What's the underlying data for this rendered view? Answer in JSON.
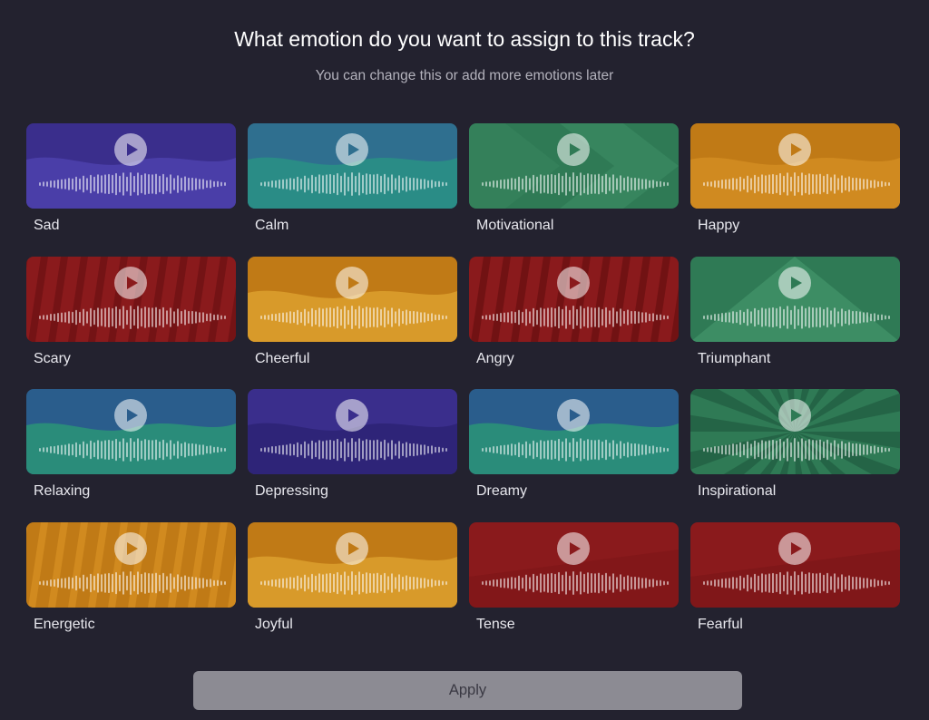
{
  "header": {
    "title": "What emotion do you want to assign to this track?",
    "subtitle": "You can change this or add more emotions later"
  },
  "emotions": [
    {
      "label": "Sad",
      "color": "#3a2e8c",
      "accent": "#4a3ea8",
      "pattern": "wave"
    },
    {
      "label": "Calm",
      "color": "#2f6f8f",
      "accent": "#2a8c86",
      "pattern": "wave"
    },
    {
      "label": "Motivational",
      "color": "#2f7a55",
      "accent": "#3b8a62",
      "pattern": "chevron"
    },
    {
      "label": "Happy",
      "color": "#c07a16",
      "accent": "#d08a20",
      "pattern": "wave"
    },
    {
      "label": "Scary",
      "color": "#8a1a1c",
      "accent": "#6e1214",
      "pattern": "spikes"
    },
    {
      "label": "Cheerful",
      "color": "#c07a16",
      "accent": "#d89a2a",
      "pattern": "wave"
    },
    {
      "label": "Angry",
      "color": "#8a1a1c",
      "accent": "#6a1012",
      "pattern": "spikes"
    },
    {
      "label": "Triumphant",
      "color": "#2f7a55",
      "accent": "#3d8d64",
      "pattern": "triangle"
    },
    {
      "label": "Relaxing",
      "color": "#2a5d8c",
      "accent": "#2a8c7a",
      "pattern": "wave"
    },
    {
      "label": "Depressing",
      "color": "#3a2e8c",
      "accent": "#2e2478",
      "pattern": "wave"
    },
    {
      "label": "Dreamy",
      "color": "#2a5d8c",
      "accent": "#2a8c7a",
      "pattern": "wave"
    },
    {
      "label": "Inspirational",
      "color": "#2f7a55",
      "accent": "#246446",
      "pattern": "rays"
    },
    {
      "label": "Energetic",
      "color": "#c07a16",
      "accent": "#d48e22",
      "pattern": "spikes"
    },
    {
      "label": "Joyful",
      "color": "#c07a16",
      "accent": "#d89a2a",
      "pattern": "wave"
    },
    {
      "label": "Tense",
      "color": "#8a1a1c",
      "accent": "#7a1416",
      "pattern": "plain"
    },
    {
      "label": "Fearful",
      "color": "#8a1a1c",
      "accent": "#761416",
      "pattern": "plain"
    }
  ],
  "icons": {
    "play": "play-icon",
    "waveform": "waveform-icon"
  },
  "footer": {
    "apply_label": "Apply"
  }
}
